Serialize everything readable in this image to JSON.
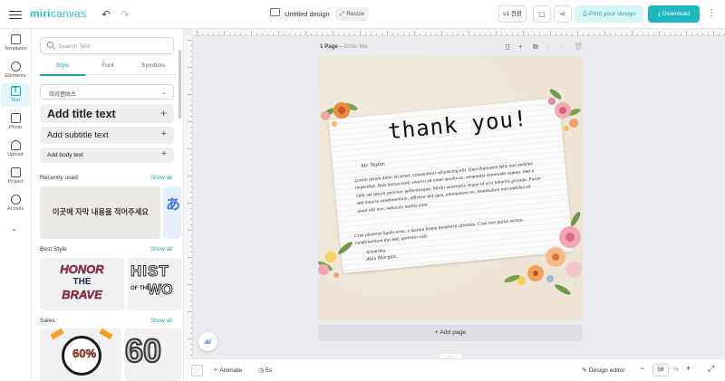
{
  "header": {
    "logo_text": "miri",
    "logo_text2": "canvas",
    "undo_icon": "↶",
    "redo_icon": "↷",
    "doc_title": "Untitled design",
    "resize_label": "Resize",
    "version_label": "v1 전환",
    "print_label": "Print your design",
    "download_label": "Download",
    "more_icon": "⋮"
  },
  "rail": {
    "items": [
      {
        "label": "Templates"
      },
      {
        "label": "Elements"
      },
      {
        "label": "Text"
      },
      {
        "label": "Photo"
      },
      {
        "label": "Upload"
      },
      {
        "label": "Project"
      },
      {
        "label": "AI tools"
      }
    ],
    "text_glyph": "T",
    "chevron": "⌄",
    "collapse": "«"
  },
  "panel": {
    "search_placeholder": "Search Text",
    "tabs": [
      "Style",
      "Font",
      "Symbols"
    ],
    "font_select_value": "미리캔버스",
    "presets": {
      "title": "Add title text",
      "subtitle": "Add subtitle text",
      "body": "Add body text",
      "plus": "+"
    },
    "sections": {
      "recent": "Recently used",
      "best": "Best Style",
      "sales": "Sales",
      "show_all": "Show all"
    },
    "thumbs": {
      "recent_text": "이곳에 자막 내용을 적어주세요",
      "recent_side": "あ",
      "honor_line1": "HONOR",
      "honor_line2": "THE",
      "honor_line3": "BRAVE",
      "hist_line1": "HIST",
      "hist_line2": "OF THE",
      "hist_line3": "WO",
      "sale_pct": "60%",
      "sale_big": "60"
    }
  },
  "canvas": {
    "page_label": "1 Page",
    "page_title_placeholder": "Enter title",
    "thank_you": "thank you!",
    "salutation": "Mr. Taylor,",
    "para1": [
      "Lorem ipsum dolor sit amet, consectetur adipiscing elit. Duis dignissim felis non sodales",
      "imperdiet. Duis lectus erat, viverra sit amet iaculis ac, venenatis commodo sapien. Sed a",
      "nibh vel ipsum pulvinar pellentesque. Morbi venenatis neque id orci lobortis gravida. Fusce",
      "sed mauris condimentum, efficitur elit quis, elementum mi. Vestibulum non sodales sit",
      "amet elit non, vehicula mattis ante."
    ],
    "para2": [
      "Cras placerat ligula urna, a lacinia lorem hendrerit ultricies. Cras non purus varius,",
      "condimentum dui sed, porttitor nisl."
    ],
    "closing": "Sincerely,",
    "signature": "Alex Morgan.",
    "add_page": "Add page",
    "ai_label": "ai"
  },
  "bottom": {
    "animate": "Animate",
    "duration": "5s",
    "design_editor": "Design editor",
    "zoom_minus": "−",
    "zoom_value": "58",
    "zoom_unit": "%",
    "zoom_plus": "+"
  },
  "colors": {
    "accent": "#1fb8be",
    "accent_light": "#d9f4f5",
    "page_bg": "#eee5d6"
  }
}
